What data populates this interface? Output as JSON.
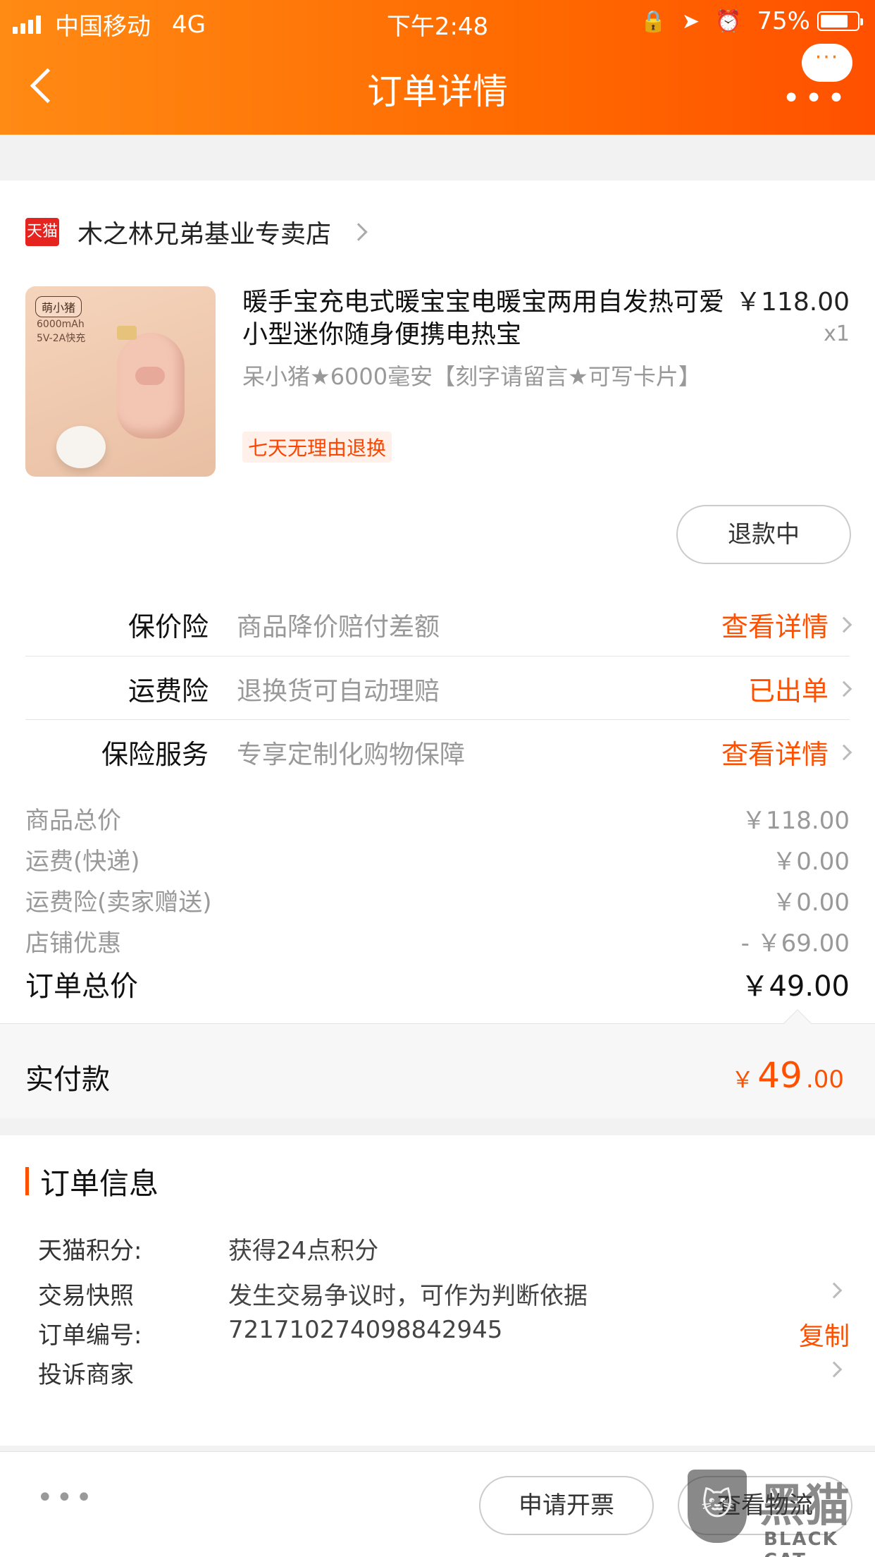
{
  "status_bar": {
    "carrier": "中国移动",
    "network": "4G",
    "time": "下午2:48",
    "battery": "75%",
    "battery_level": 0.75
  },
  "nav": {
    "title": "订单详情",
    "bubble_dots": "···",
    "menu_dots": "•••"
  },
  "store": {
    "logo_text": "天猫",
    "name": "木之林兄弟基业专卖店"
  },
  "product": {
    "thumb_badge": "萌小猪",
    "thumb_capacity": "6000mAh",
    "thumb_charge": "5V-2A快充",
    "title": "暖手宝充电式暖宝宝电暖宝两用自发热可爱小型迷你随身便携电热宝",
    "price": "￥118.00",
    "quantity": "x1",
    "sku": "呆小猪★6000毫安【刻字请留言★可写卡片】",
    "tag": "七天无理由退换",
    "refund_status": "退款中"
  },
  "insurance": [
    {
      "label": "保价险",
      "desc": "商品降价赔付差额",
      "action": "查看详情"
    },
    {
      "label": "运费险",
      "desc": "退换货可自动理赔",
      "action": "已出单"
    },
    {
      "label": "保险服务",
      "desc": "专享定制化购物保障",
      "action": "查看详情"
    }
  ],
  "summary": [
    {
      "label": "商品总价",
      "value": "￥118.00"
    },
    {
      "label": "运费(快递)",
      "value": "￥0.00"
    },
    {
      "label": "运费险(卖家赠送)",
      "value": "￥0.00"
    },
    {
      "label": "店铺优惠",
      "value": "- ￥69.00"
    }
  ],
  "total": {
    "label": "订单总价",
    "value": "￥49.00"
  },
  "paid": {
    "label": "实付款",
    "currency": "￥",
    "integer": "49",
    "decimal": ".00"
  },
  "order_info": {
    "title": "订单信息",
    "rows": [
      {
        "key": "天猫积分:",
        "value": "获得24点积分"
      },
      {
        "key": "交易快照",
        "value": "发生交易争议时，可作为判断依据"
      },
      {
        "key": "订单编号:",
        "value": "721710274098842945",
        "action": "复制"
      },
      {
        "key": "投诉商家",
        "value": ""
      }
    ]
  },
  "bottom_bar": {
    "more": "•••",
    "invoice": "申请开票",
    "logistics": "查看物流"
  },
  "watermark": {
    "cn": "黑猫",
    "en": "BLACK CAT"
  },
  "colors": {
    "accent": "#ff5000",
    "header_start": "#ff8a14",
    "header_end": "#ff5000",
    "tmall_red": "#e5231f"
  }
}
